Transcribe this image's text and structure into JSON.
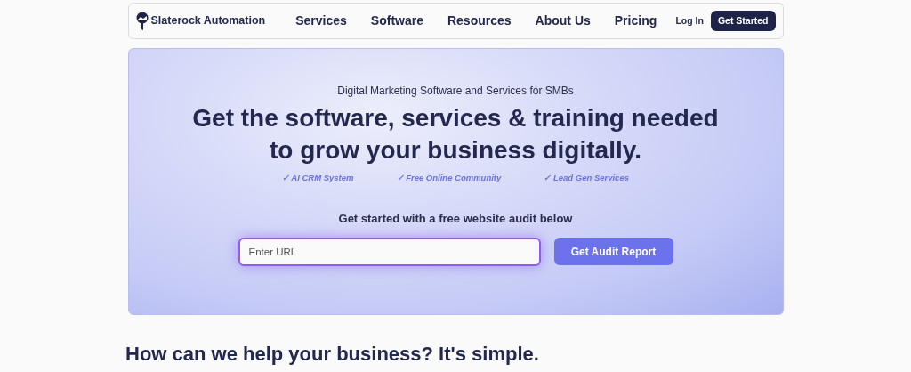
{
  "nav": {
    "brand": "Slaterock Automation",
    "links": [
      "Services",
      "Software",
      "Resources",
      "About Us",
      "Pricing"
    ],
    "login": "Log In",
    "cta": "Get Started"
  },
  "hero": {
    "eyebrow": "Digital Marketing Software and Services for SMBs",
    "title_lines": [
      "Get the software, services & training needed",
      "to grow your business digitally."
    ],
    "features": [
      "✓ AI CRM System",
      "✓ Free Online Community",
      "✓ Lead Gen Services"
    ],
    "prompt": "Get started with a free website audit below",
    "url_field": {
      "placeholder": "Enter URL"
    },
    "submit": "Get Audit Report"
  },
  "section": {
    "heading": "How can we help your business? It's simple."
  }
}
